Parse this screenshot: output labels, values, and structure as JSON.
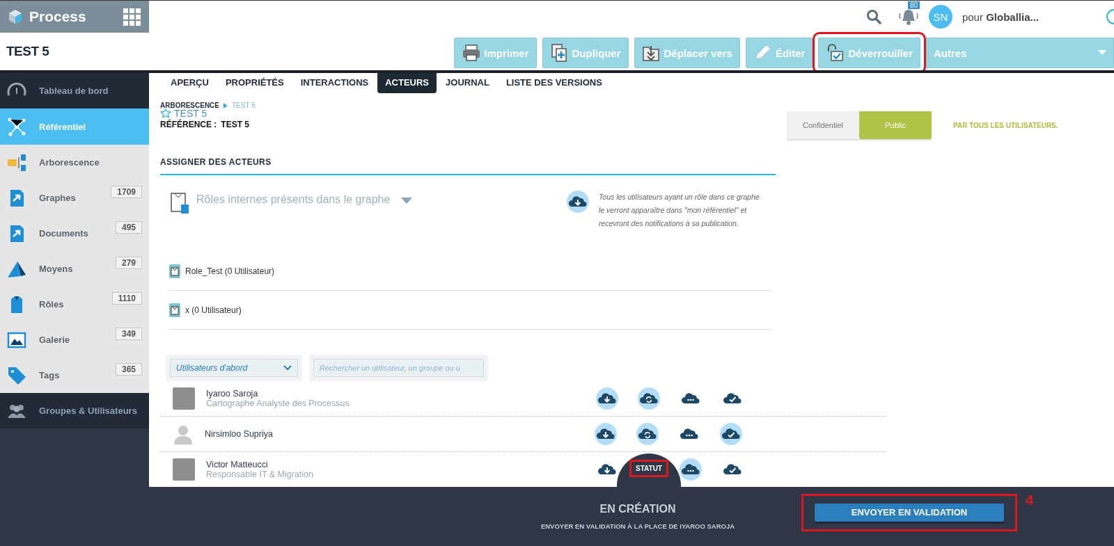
{
  "app": {
    "name": "Process"
  },
  "page_title": "TEST 5",
  "top_bar": {
    "notifications": "80",
    "avatar_initials": "SN",
    "account_prefix": "pour",
    "account_name": "Globallia..."
  },
  "toolbar": [
    {
      "kind": "print",
      "label": "Imprimer",
      "annotated": false
    },
    {
      "kind": "duplicate",
      "label": "Dupliquer",
      "annotated": false
    },
    {
      "kind": "move",
      "label": "Déplacer vers",
      "annotated": false
    },
    {
      "kind": "edit",
      "label": "Éditer",
      "annotated": false
    },
    {
      "kind": "unlock",
      "label": "Déverrouiller",
      "annotated": true
    },
    {
      "kind": "more",
      "label": "Autres",
      "annotated": false
    }
  ],
  "sidebar": {
    "items": [
      {
        "kind": "dashboard",
        "label": "Tableau de bord",
        "dark": true,
        "selected": false
      },
      {
        "kind": "repository",
        "label": "Référentiel",
        "dark": true,
        "selected": true
      },
      {
        "kind": "tree",
        "label": "Arborescence",
        "dark": false,
        "selected": false
      },
      {
        "kind": "graph",
        "label": "Graphes",
        "count": "1709",
        "dark": false,
        "selected": false
      },
      {
        "kind": "document",
        "label": "Documents",
        "count": "495",
        "dark": false,
        "selected": false
      },
      {
        "kind": "means",
        "label": "Moyens",
        "count": "279",
        "dark": false,
        "selected": false
      },
      {
        "kind": "role",
        "label": "Rôles",
        "count": "1110",
        "dark": false,
        "selected": false
      },
      {
        "kind": "gallery",
        "label": "Galerie",
        "count": "349",
        "dark": false,
        "selected": false
      },
      {
        "kind": "tag",
        "label": "Tags",
        "count": "365",
        "dark": false,
        "selected": false
      },
      {
        "kind": "users",
        "label": "Groupes & Utilisateurs",
        "dark": true,
        "selected": false
      }
    ]
  },
  "tabs": [
    {
      "label": "APERÇU",
      "selected": false
    },
    {
      "label": "PROPRIÉTÉS",
      "selected": false
    },
    {
      "label": "INTERACTIONS",
      "selected": false
    },
    {
      "label": "ACTEURS",
      "selected": true
    },
    {
      "label": "JOURNAL",
      "selected": false
    },
    {
      "label": "LISTE DES VERSIONS",
      "selected": false
    }
  ],
  "breadcrumb": [
    "ARBORESCENCE",
    "TEST 5"
  ],
  "document": {
    "title": "TEST 5",
    "reference_label": "RÉFÉRENCE :",
    "reference": "TEST 5"
  },
  "visibility": {
    "options": [
      {
        "label": "Confidentiel",
        "selected": false
      },
      {
        "label": "Public",
        "selected": true
      }
    ],
    "note": "PAR TOUS LES UTILISATEURS."
  },
  "assign": {
    "heading": "ASSIGNER DES ACTEURS",
    "roles_dropdown": "Rôles internes présents dans le graphe",
    "info": "Tous les utilisateurs ayant un rôle dans ce graphe le verront apparaître dans \"mon référentiel\" et recevront des notifications à sa publication.",
    "roles": [
      "Role_Test (0 Utilisateur)",
      "x (0 Utilisateur)"
    ],
    "sort": "Utilisateurs d'abord",
    "search": {
      "placeholder": "Rechercher un utilisateur, un groupe ou u"
    },
    "users": [
      {
        "name": "Iyaroo Saroja",
        "role": "Cartographe Analyste des Processus",
        "has_photo": true,
        "actions": [
          {
            "kind": "download",
            "on": true
          },
          {
            "kind": "sync",
            "on": true
          },
          {
            "kind": "dots",
            "on": false
          },
          {
            "kind": "check",
            "on": false
          }
        ]
      },
      {
        "name": "Nirsimloo Supriya",
        "has_photo": false,
        "actions": [
          {
            "kind": "download",
            "on": true
          },
          {
            "kind": "sync",
            "on": true
          },
          {
            "kind": "dots",
            "on": false
          },
          {
            "kind": "check",
            "on": true
          }
        ]
      },
      {
        "name": "Victor Matteucci",
        "role": "Responsable IT & Migration",
        "has_photo": true,
        "actions": [
          {
            "kind": "download",
            "on": false
          },
          {
            "kind": "dots",
            "on": true
          },
          {
            "kind": "check",
            "on": false
          }
        ]
      }
    ]
  },
  "footer": {
    "status_tab": "STATUT",
    "status": "EN CRÉATION",
    "subtitle": "ENVOYER EN VALIDATION À LA PLACE DE IYAROO SAROJA",
    "button": "ENVOYER EN VALIDATION",
    "annotation": "4"
  }
}
